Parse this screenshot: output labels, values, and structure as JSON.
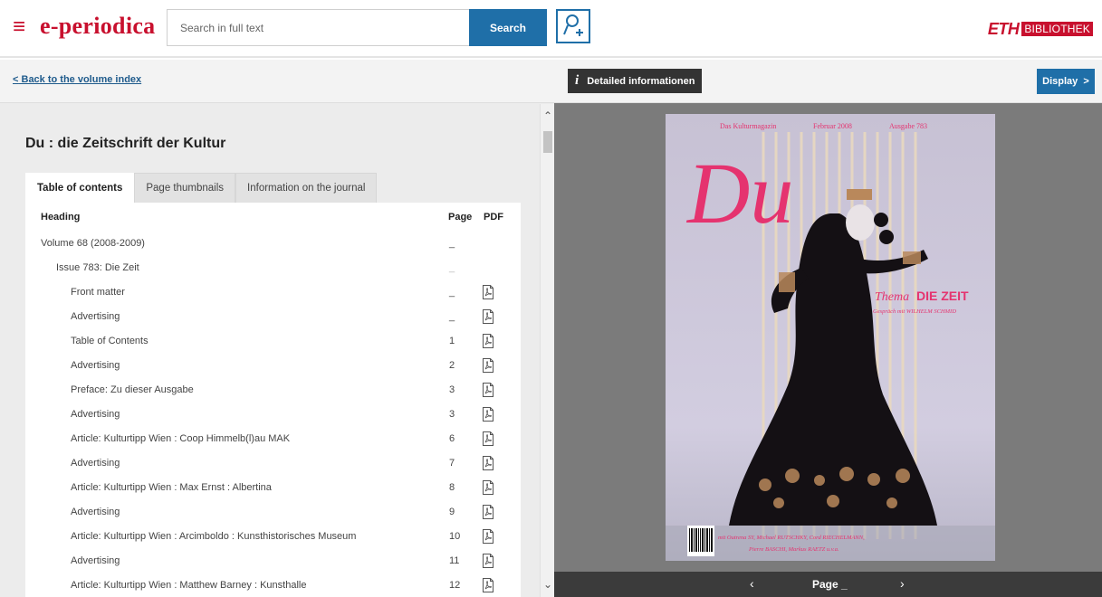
{
  "header": {
    "brand": "e-periodica",
    "search_placeholder": "Search in full text",
    "search_label": "Search",
    "logo_word": "ETH",
    "logo_box": "BIBLIOTHEK"
  },
  "left": {
    "back_link": "Back to the volume index",
    "journal_title": "Du : die Zeitschrift der Kultur",
    "tabs": [
      {
        "label": "Table of contents"
      },
      {
        "label": "Page thumbnails"
      },
      {
        "label": "Information on the journal"
      }
    ],
    "columns": {
      "heading": "Heading",
      "page": "Page",
      "pdf": "PDF"
    },
    "rows": [
      {
        "title": "Volume 68 (2008-2009)",
        "page": "_"
      },
      {
        "title": "Issue 783: Die Zeit",
        "page": "_"
      },
      {
        "title": "Front matter",
        "page": "_"
      },
      {
        "title": "Advertising",
        "page": "_"
      },
      {
        "title": "Table of Contents",
        "page": "1"
      },
      {
        "title": "Advertising",
        "page": "2"
      },
      {
        "title": "Preface: Zu dieser Ausgabe",
        "page": "3"
      },
      {
        "title": "Advertising",
        "page": "3"
      },
      {
        "title": "Article: Kulturtipp Wien : Coop Himmelb(l)au MAK",
        "page": "6"
      },
      {
        "title": "Advertising",
        "page": "7"
      },
      {
        "title": "Article: Kulturtipp Wien : Max Ernst : Albertina",
        "page": "8"
      },
      {
        "title": "Advertising",
        "page": "9"
      },
      {
        "title": "Article: Kulturtipp Wien : Arcimboldo : Kunsthistorisches Museum",
        "page": "10"
      },
      {
        "title": "Advertising",
        "page": "11"
      },
      {
        "title": "Article: Kulturtipp Wien : Matthew Barney : Kunsthalle",
        "page": "12"
      }
    ]
  },
  "viewer": {
    "details_label": "Detailed informationen",
    "details_glyph": "i",
    "display_label": "Display",
    "cover": {
      "masthead": "Du",
      "header_left": "Das Kulturmagazin",
      "header_mid": "Februar 2008",
      "header_right": "Ausgabe 783",
      "thema_prefix": "Thema",
      "thema_title": "DIE ZEIT",
      "subline": "Gespräch mit WILHELM SCHMID",
      "credits_1": "mit Outrena SY, Michael RUTSCHKY, Cord RIECHELMANN,",
      "credits_2": "Pierre BASCHI, Markus RAETZ u.v.a."
    },
    "page_label": "Page _",
    "prev": "‹",
    "next": "›"
  },
  "colors": {
    "brand_red": "#c8102e",
    "primary_blue": "#1f6fa8",
    "cover_pink": "#e5336f"
  }
}
